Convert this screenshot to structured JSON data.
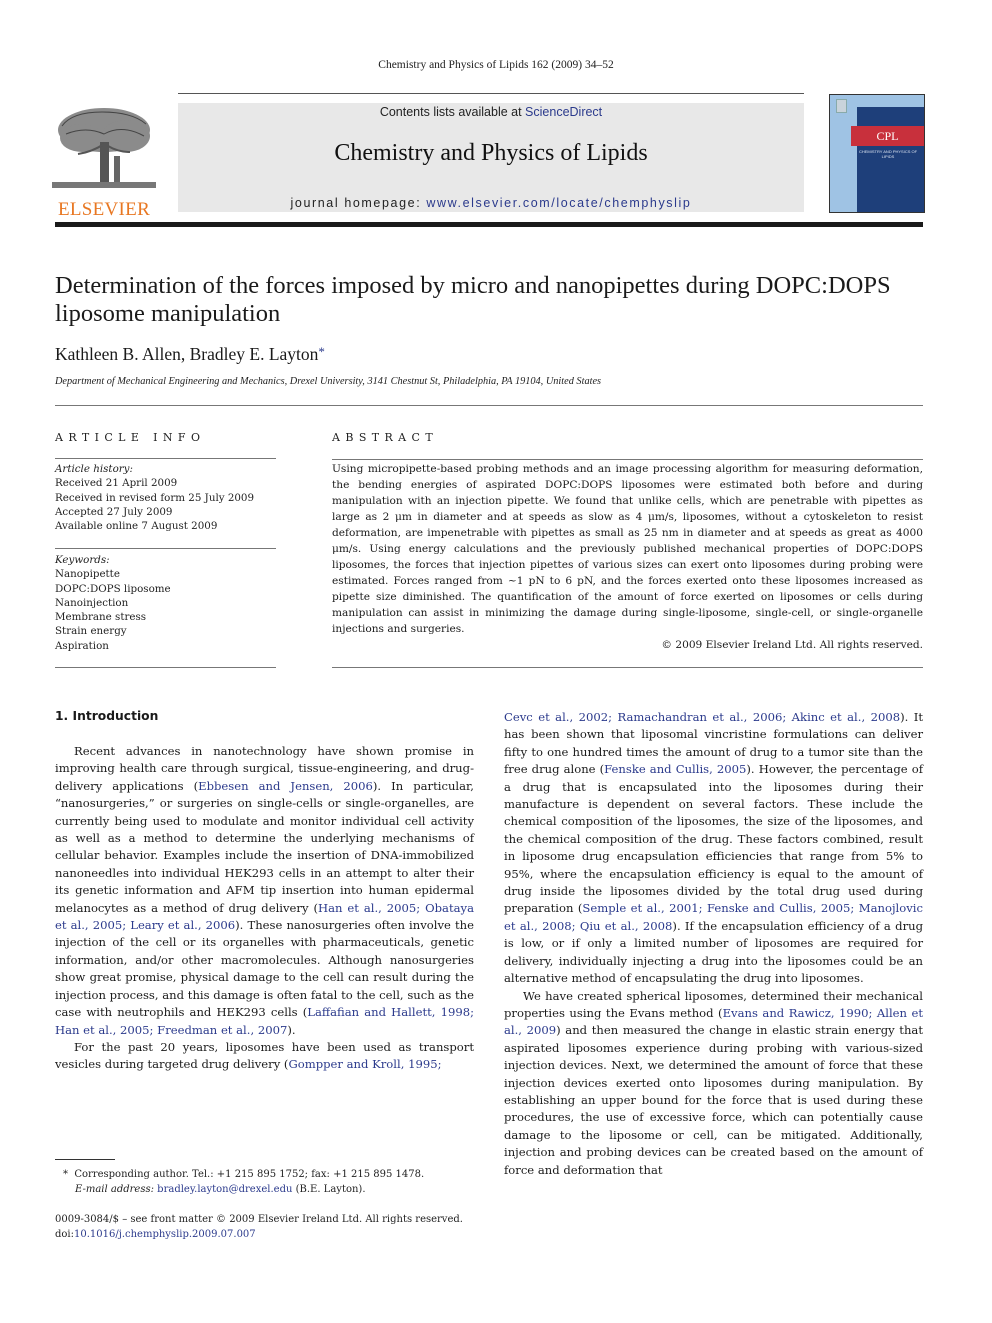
{
  "running_head": "Chemistry and Physics of Lipids 162 (2009) 34–52",
  "publisher": {
    "logo_word": "ELSEVIER",
    "logo_color": "#e87722"
  },
  "banner": {
    "contents_prefix": "Contents lists available at ",
    "contents_link": "ScienceDirect",
    "journal_title": "Chemistry and Physics of Lipids",
    "homepage_prefix": "journal homepage: ",
    "homepage_link": "www.elsevier.com/locate/chemphyslip"
  },
  "cover": {
    "abbrev": "CPL",
    "subtitle": "CHEMISTRY AND PHYSICS OF LIPIDS"
  },
  "article": {
    "title": "Determination of the forces imposed by micro and nanopipettes during DOPC:DOPS liposome manipulation",
    "authors": "Kathleen B. Allen, Bradley E. Layton",
    "author_mark": "*",
    "affiliation": "Department of Mechanical Engineering and Mechanics, Drexel University, 3141 Chestnut St, Philadelphia, PA 19104, United States"
  },
  "article_info": {
    "heading": "ARTICLE INFO",
    "history_label": "Article history:",
    "history": [
      "Received 21 April 2009",
      "Received in revised form 25 July 2009",
      "Accepted 27 July 2009",
      "Available online 7 August 2009"
    ],
    "keywords_label": "Keywords:",
    "keywords": [
      "Nanopipette",
      "DOPC:DOPS liposome",
      "Nanoinjection",
      "Membrane stress",
      "Strain energy",
      "Aspiration"
    ]
  },
  "abstract": {
    "heading": "ABSTRACT",
    "text": "Using micropipette-based probing methods and an image processing algorithm for measuring deformation, the bending energies of aspirated DOPC:DOPS liposomes were estimated both before and during manipulation with an injection pipette. We found that unlike cells, which are penetrable with pipettes as large as 2 μm in diameter and at speeds as slow as 4 μm/s, liposomes, without a cytoskeleton to resist deformation, are impenetrable with pipettes as small as 25 nm in diameter and at speeds as great as 4000 μm/s. Using energy calculations and the previously published mechanical properties of DOPC:DOPS liposomes, the forces that injection pipettes of various sizes can exert onto liposomes during probing were estimated. Forces ranged from ~1 pN to 6 pN, and the forces exerted onto these liposomes increased as pipette size diminished. The quantification of the amount of force exerted on liposomes or cells during manipulation can assist in minimizing the damage during single-liposome, single-cell, or single-organelle injections and surgeries.",
    "copyright": "© 2009 Elsevier Ireland Ltd. All rights reserved."
  },
  "intro": {
    "heading": "1.  Introduction",
    "left": {
      "p1_a": "Recent advances in nanotechnology have shown promise in improving health care through surgical, tissue-engineering, and drug-delivery applications (",
      "p1_c1": "Ebbesen and Jensen, 2006",
      "p1_b": "). In particular, “nanosurgeries,” or surgeries on single-cells or single-organelles, are currently being used to modulate and monitor individual cell activity as well as a method to determine the underlying mechanisms of cellular behavior. Examples include the insertion of DNA-immobilized nanoneedles into individual HEK293 cells in an attempt to alter their its genetic information and AFM tip insertion into human epidermal melanocytes as a method of drug delivery (",
      "p1_c2": "Han et al., 2005; Obataya et al., 2005; Leary et al., 2006",
      "p1_c": "). These nanosurgeries often involve the injection of the cell or its organelles with pharmaceuticals, genetic information, and/or other macromolecules. Although nanosurgeries show great promise, physical damage to the cell can result during the injection process, and this damage is often fatal to the cell, such as the case with neutrophils and HEK293 cells (",
      "p1_c3": "Laffafian and Hallett, 1998; Han et al., 2005; Freedman et al., 2007",
      "p1_d": ").",
      "p2_a": "For the past 20 years, liposomes have been used as transport vesicles during targeted drug delivery (",
      "p2_c1": "Gompper and Kroll, 1995;"
    },
    "right": {
      "p2_c1": "Cevc et al., 2002; Ramachandran et al., 2006; Akinc et al., 2008",
      "p2_a": "). It has been shown that liposomal vincristine formulations can deliver fifty to one hundred times the amount of drug to a tumor site than the free drug alone (",
      "p2_c2": "Fenske and Cullis, 2005",
      "p2_b": "). However, the percentage of a drug that is encapsulated into the liposomes during their manufacture is dependent on several factors. These include the chemical composition of the liposomes, the size of the liposomes, and the chemical composition of the drug. These factors combined, result in liposome drug encapsulation efficiencies that range from 5% to 95%, where the encapsulation efficiency is equal to the amount of drug inside the liposomes divided by the total drug used during preparation (",
      "p2_c3": "Semple et al., 2001; Fenske and Cullis, 2005; Manojlovic et al., 2008; Qiu et al., 2008",
      "p2_c": "). If the encapsulation efficiency of a drug is low, or if only a limited number of liposomes are required for delivery, individually injecting a drug into the liposomes could be an alternative method of encapsulating the drug into liposomes.",
      "p3_a": "We have created spherical liposomes, determined their mechanical properties using the Evans method (",
      "p3_c1": "Evans and Rawicz, 1990; Allen et al., 2009",
      "p3_b": ") and then measured the change in elastic strain energy that aspirated liposomes experience during probing with various-sized injection devices. Next, we determined the amount of force that these injection devices exerted onto liposomes during manipulation. By establishing an upper bound for the force that is used during these procedures, the use of excessive force, which can potentially cause damage to the liposome or cell, can be mitigated. Additionally, injection and probing devices can be created based on the amount of force and deformation that"
    }
  },
  "footnote": {
    "mark": "*",
    "corresponding": "Corresponding author. Tel.: +1 215 895 1752; fax: +1 215 895 1478.",
    "email_label": "E-mail address: ",
    "email": "bradley.layton@drexel.edu",
    "email_suffix": " (B.E. Layton)."
  },
  "front_matter": {
    "issn_line": "0009-3084/$ – see front matter © 2009 Elsevier Ireland Ltd. All rights reserved.",
    "doi_prefix": "doi:",
    "doi": "10.1016/j.chemphyslip.2009.07.007"
  }
}
